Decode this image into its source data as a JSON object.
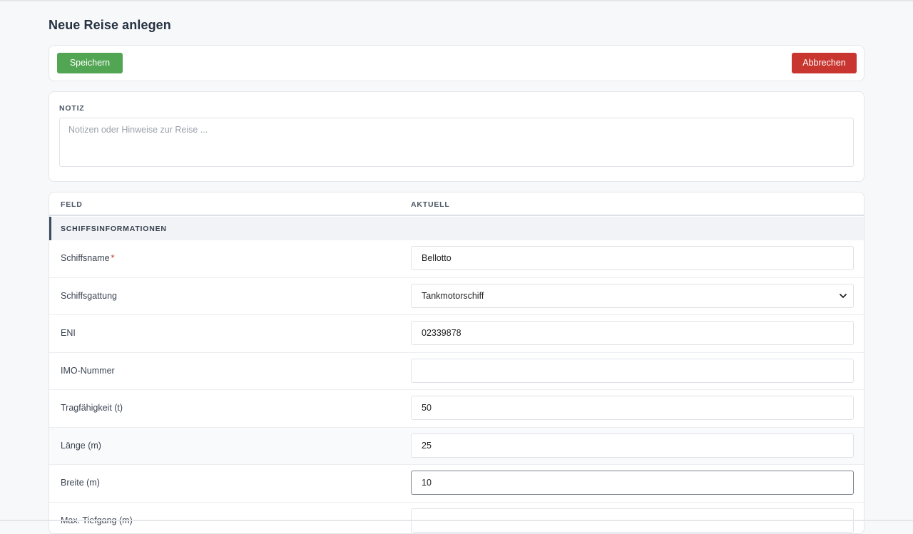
{
  "page": {
    "title": "Neue Reise anlegen"
  },
  "actions": {
    "save_label": "Speichern",
    "cancel_label": "Abbrechen"
  },
  "note": {
    "label": "NOTIZ",
    "placeholder": "Notizen oder Hinweise zur Reise ...",
    "value": ""
  },
  "table": {
    "headers": {
      "field": "FELD",
      "current": "AKTUELL"
    },
    "section": "SCHIFFSINFORMATIONEN",
    "rows": [
      {
        "label": "Schiffsname",
        "required": "*",
        "value": "Bellotto",
        "type": "text"
      },
      {
        "label": "Schiffsgattung",
        "value": "Tankmotorschiff",
        "type": "select"
      },
      {
        "label": "ENI",
        "value": "02339878",
        "type": "text"
      },
      {
        "label": "IMO-Nummer",
        "value": "",
        "type": "text"
      },
      {
        "label": "Tragfähigkeit (t)",
        "value": "50",
        "type": "text"
      },
      {
        "label": "Länge (m)",
        "value": "25",
        "type": "text"
      },
      {
        "label": "Breite (m)",
        "value": "10",
        "type": "text"
      },
      {
        "label": "Max. Tiefgang (m)",
        "value": "",
        "type": "text"
      }
    ]
  },
  "colors": {
    "save": "#52a553",
    "cancel": "#c8362f",
    "background": "#f7f8fa"
  }
}
